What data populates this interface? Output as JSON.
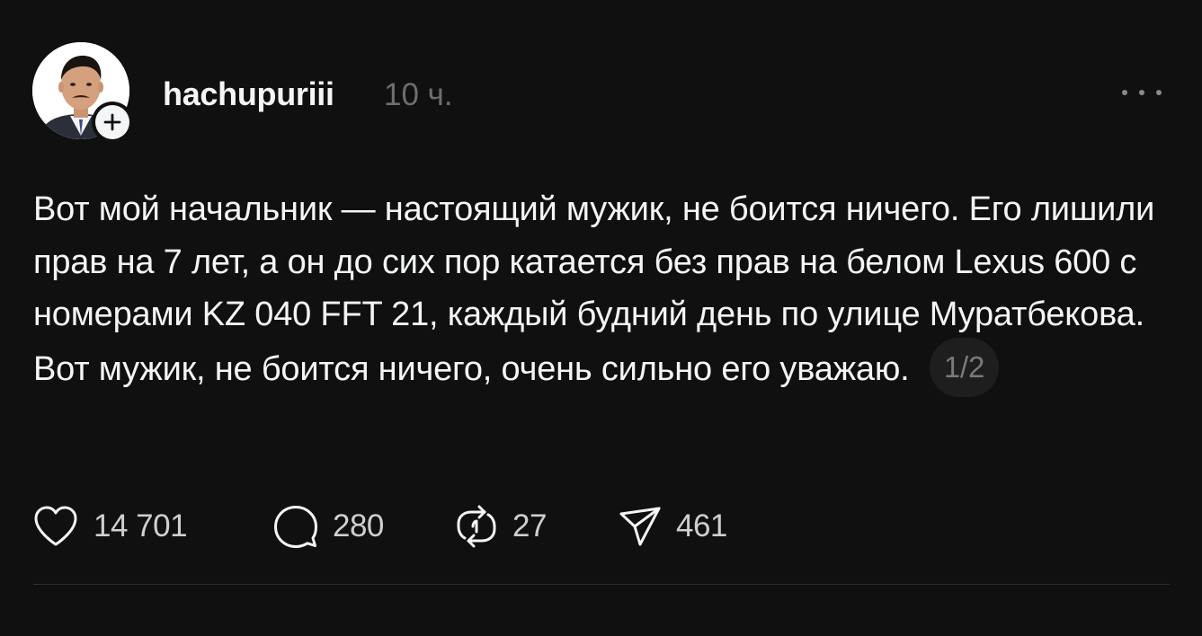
{
  "post": {
    "username": "hachupuriii",
    "timestamp": "10 ч.",
    "text": "Вот мой начальник — настоящий мужик, не боится ничего. Его лишили прав на 7 лет, а он до сих пор катается без прав на белом Lexus 600 с номерами KZ 040 FFT 21, каждый будний день по улице Муратбекова. Вот мужик, не боится ничего, очень сильно его уважаю.",
    "page_indicator": "1/2"
  },
  "actions": {
    "likes": "14 701",
    "comments": "280",
    "reposts": "27",
    "shares": "461"
  },
  "icons": {
    "avatar": "profile-photo",
    "follow": "plus-icon",
    "more": "more-horizontal-icon",
    "like": "heart-icon",
    "comment": "comment-bubble-icon",
    "repost": "repost-icon",
    "share": "send-icon"
  },
  "colors": {
    "background": "#101010",
    "text": "#f3f5f7",
    "muted": "#6e6e6e"
  }
}
